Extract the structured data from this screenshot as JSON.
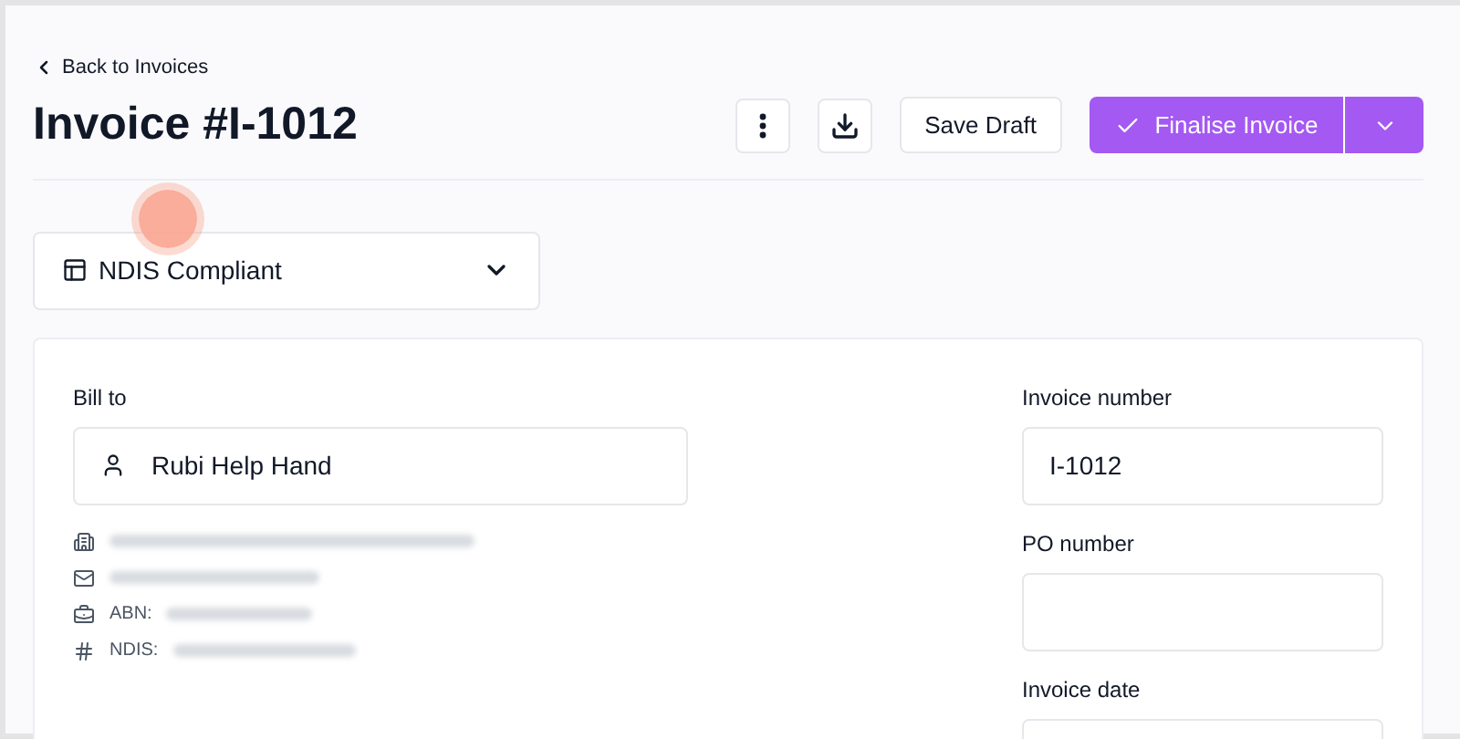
{
  "back_link": "Back to Invoices",
  "title": "Invoice #I-1012",
  "actions": {
    "save_draft": "Save Draft",
    "finalise": "Finalise Invoice"
  },
  "compliance_select": {
    "value": "NDIS Compliant"
  },
  "bill_to": {
    "label": "Bill to",
    "client": "Rubi Help Hand",
    "details": [
      {
        "kind": "address"
      },
      {
        "kind": "email"
      },
      {
        "kind": "abn",
        "label": "ABN:"
      },
      {
        "kind": "ndis",
        "label": "NDIS:"
      }
    ]
  },
  "fields": [
    {
      "label": "Invoice number",
      "value": "I-1012"
    },
    {
      "label": "PO number"
    },
    {
      "label": "Invoice date"
    }
  ]
}
